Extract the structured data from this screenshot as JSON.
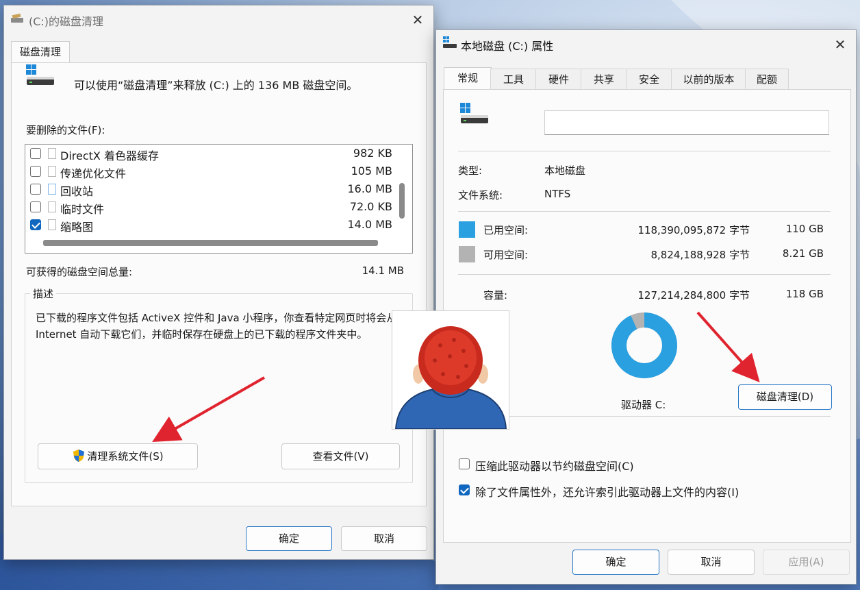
{
  "left_window": {
    "title": "(C:)的磁盘清理",
    "tab": "磁盘清理",
    "summary": "可以使用“磁盘清理”来释放  (C:) 上的 136 MB 磁盘空间。",
    "files_label": "要删除的文件(F):",
    "files": [
      {
        "name": "DirectX 着色器缓存",
        "size": "982 KB",
        "checked": false
      },
      {
        "name": "传递优化文件",
        "size": "105 MB",
        "checked": false
      },
      {
        "name": "回收站",
        "size": "16.0 MB",
        "checked": false
      },
      {
        "name": "临时文件",
        "size": "72.0 KB",
        "checked": false
      },
      {
        "name": "缩略图",
        "size": "14.0 MB",
        "checked": true
      }
    ],
    "total_label": "可获得的磁盘空间总量:",
    "total_value": "14.1 MB",
    "desc_label": "描述",
    "description": "已下载的程序文件包括 ActiveX 控件和 Java 小程序，你查看特定网页时将会从 Internet 自动下载它们，并临时保存在硬盘上的已下载的程序文件夹中。",
    "clean_system_button": "清理系统文件(S)",
    "view_files_button": "查看文件(V)",
    "ok_button": "确定",
    "cancel_button": "取消"
  },
  "right_window": {
    "title": "本地磁盘 (C:) 属性",
    "tabs": [
      "常规",
      "工具",
      "硬件",
      "共享",
      "安全",
      "以前的版本",
      "配额"
    ],
    "name_value": "",
    "type_label": "类型:",
    "type_value": "本地磁盘",
    "fs_label": "文件系统:",
    "fs_value": "NTFS",
    "used_label": "已用空间:",
    "used_bytes": "118,390,095,872 字节",
    "used_gb": "110 GB",
    "free_label": "可用空间:",
    "free_bytes": "8,824,188,928 字节",
    "free_gb": "8.21 GB",
    "capacity_label": "容量:",
    "capacity_bytes": "127,214,284,800 字节",
    "capacity_gb": "118 GB",
    "drive_label": "驱动器 C:",
    "cleanup_button": "磁盘清理(D)",
    "compress_label": "压缩此驱动器以节约磁盘空间(C)",
    "compress_checked": false,
    "index_label": "除了文件属性外，还允许索引此驱动器上文件的内容(I)",
    "index_checked": true,
    "ok_button": "确定",
    "cancel_button": "取消",
    "apply_button": "应用(A)",
    "used_fraction": 0.9306
  },
  "colors": {
    "used": "#2aa0e0",
    "free": "#b3b3b3",
    "arrow": "#e0242f",
    "accent": "#0f67c0"
  }
}
